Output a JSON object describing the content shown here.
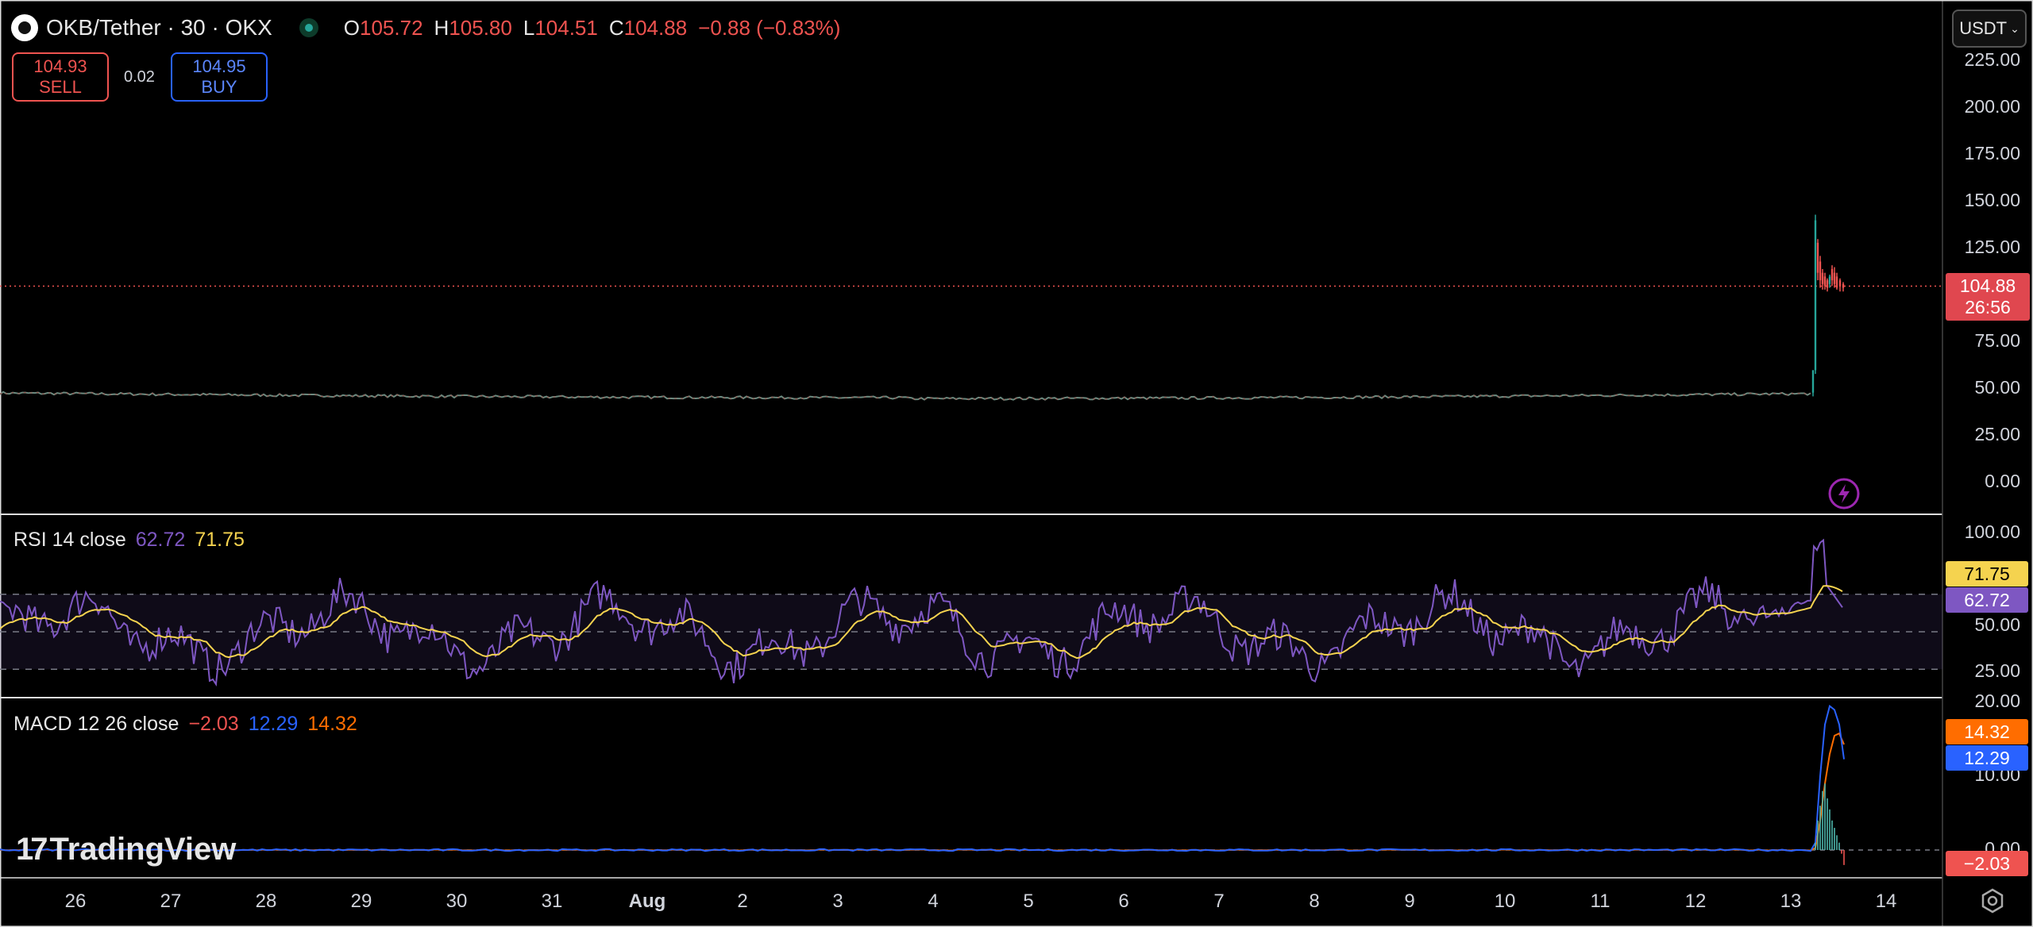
{
  "header": {
    "symbol": "OKB/Tether · 30 · OKX",
    "open_label": "O",
    "open": "105.72",
    "high_label": "H",
    "high": "105.80",
    "low_label": "L",
    "low": "104.51",
    "close_label": "C",
    "close": "104.88",
    "change": "−0.88 (−0.83%)"
  },
  "trade": {
    "sell_price": "104.93",
    "sell_label": "SELL",
    "spread": "0.02",
    "buy_price": "104.95",
    "buy_label": "BUY"
  },
  "currency_selector": "USDT",
  "price_axis": {
    "ticks": [
      "225.00",
      "200.00",
      "175.00",
      "150.00",
      "125.00",
      "75.00",
      "50.00",
      "25.00",
      "0.00"
    ],
    "last_price": "104.88",
    "countdown": "26:56"
  },
  "rsi": {
    "title": "RSI 14 close",
    "value": "62.72",
    "ma_value": "71.75",
    "ticks": [
      "100.00",
      "50.00",
      "25.00"
    ]
  },
  "macd": {
    "title": "MACD 12 26 close",
    "hist_value": "−2.03",
    "macd_value": "12.29",
    "signal_value": "14.32",
    "ticks": [
      "20.00",
      "10.00",
      "0.00"
    ]
  },
  "time_axis": [
    "26",
    "27",
    "28",
    "29",
    "30",
    "31",
    "Aug",
    "2",
    "3",
    "4",
    "5",
    "6",
    "7",
    "8",
    "9",
    "10",
    "11",
    "12",
    "13",
    "14"
  ],
  "branding": "TradingView",
  "colors": {
    "up": "#26a69a",
    "down": "#ef5350",
    "rsi": "#7e57c2",
    "rsi_ma": "#f5d34f",
    "macd": "#2962ff",
    "signal": "#ff6d00"
  },
  "chart_data": {
    "type": "line",
    "price_series": {
      "x": [
        "Jul 26",
        "Jul 28",
        "Jul 30",
        "Aug 1",
        "Aug 3",
        "Aug 5",
        "Aug 7",
        "Aug 9",
        "Aug 11",
        "Aug 13 00:00",
        "Aug 13 02:00",
        "Aug 13 04:00",
        "Aug 13 08:00",
        "Aug 13 12:00"
      ],
      "y": [
        47.5,
        48.0,
        47.2,
        46.8,
        45.5,
        45.8,
        45.9,
        46.5,
        46.8,
        46.3,
        143.0,
        124.0,
        112.0,
        104.88
      ]
    },
    "price_ylim": [
      0,
      225
    ],
    "rsi_ylim": [
      20,
      100
    ],
    "rsi_bands": [
      30,
      50,
      70
    ],
    "macd_ylim": [
      -5,
      20
    ],
    "macd": {
      "macd": 12.29,
      "signal": 14.32,
      "histogram": -2.03
    }
  }
}
